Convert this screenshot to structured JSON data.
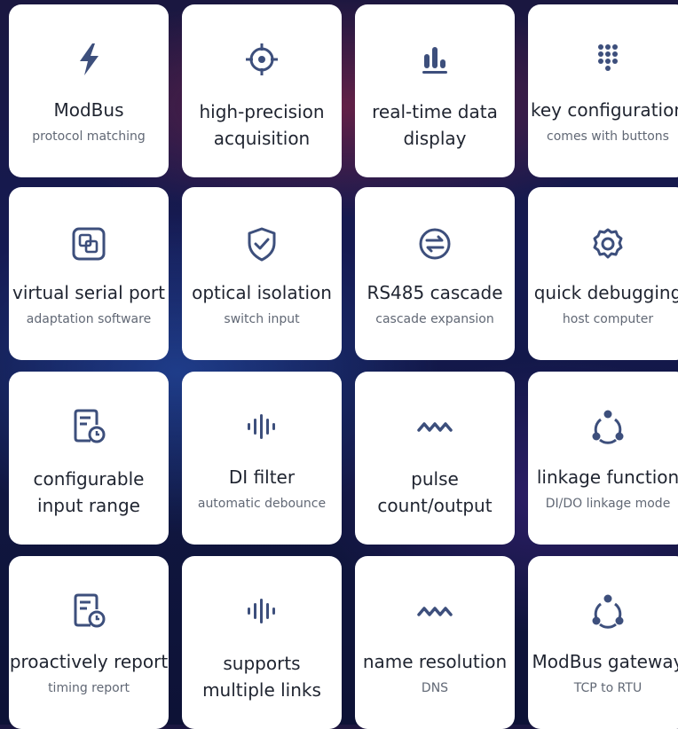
{
  "cards": [
    {
      "title": "ModBus",
      "subtitle": "protocol matching",
      "icon": "lightning-icon"
    },
    {
      "title": "high-precision acquisition",
      "subtitle": "",
      "icon": "crosshair-icon"
    },
    {
      "title": "real-time data display",
      "subtitle": "",
      "icon": "bar-chart-icon"
    },
    {
      "title": "key configuration",
      "subtitle": "comes with buttons",
      "icon": "keypad-icon"
    },
    {
      "title": "virtual serial port",
      "subtitle": "adaptation software",
      "icon": "copy-squares-icon"
    },
    {
      "title": "optical isolation",
      "subtitle": "switch input",
      "icon": "shield-check-icon"
    },
    {
      "title": "RS485 cascade",
      "subtitle": "cascade expansion",
      "icon": "exchange-circle-icon"
    },
    {
      "title": "quick debugging",
      "subtitle": "host computer",
      "icon": "gear-icon"
    },
    {
      "title": "configurable input range",
      "subtitle": "",
      "icon": "document-clock-icon"
    },
    {
      "title": "DI filter",
      "subtitle": "automatic debounce",
      "icon": "audio-wave-icon"
    },
    {
      "title": "pulse count/output",
      "subtitle": "",
      "icon": "zigzag-wave-icon"
    },
    {
      "title": "linkage function",
      "subtitle": "DI/DO linkage mode",
      "icon": "share-nodes-icon"
    },
    {
      "title": "proactively report",
      "subtitle": "timing report",
      "icon": "document-clock-icon"
    },
    {
      "title": "supports multiple links",
      "subtitle": "",
      "icon": "audio-wave-icon"
    },
    {
      "title": "name resolution",
      "subtitle": "DNS",
      "icon": "zigzag-wave-icon"
    },
    {
      "title": "ModBus gateway",
      "subtitle": "TCP to RTU",
      "icon": "share-nodes-icon"
    }
  ],
  "colors": {
    "icon": "#3d4f7c",
    "card": "#ffffff",
    "title": "#1f2430",
    "subtitle": "#616875"
  }
}
